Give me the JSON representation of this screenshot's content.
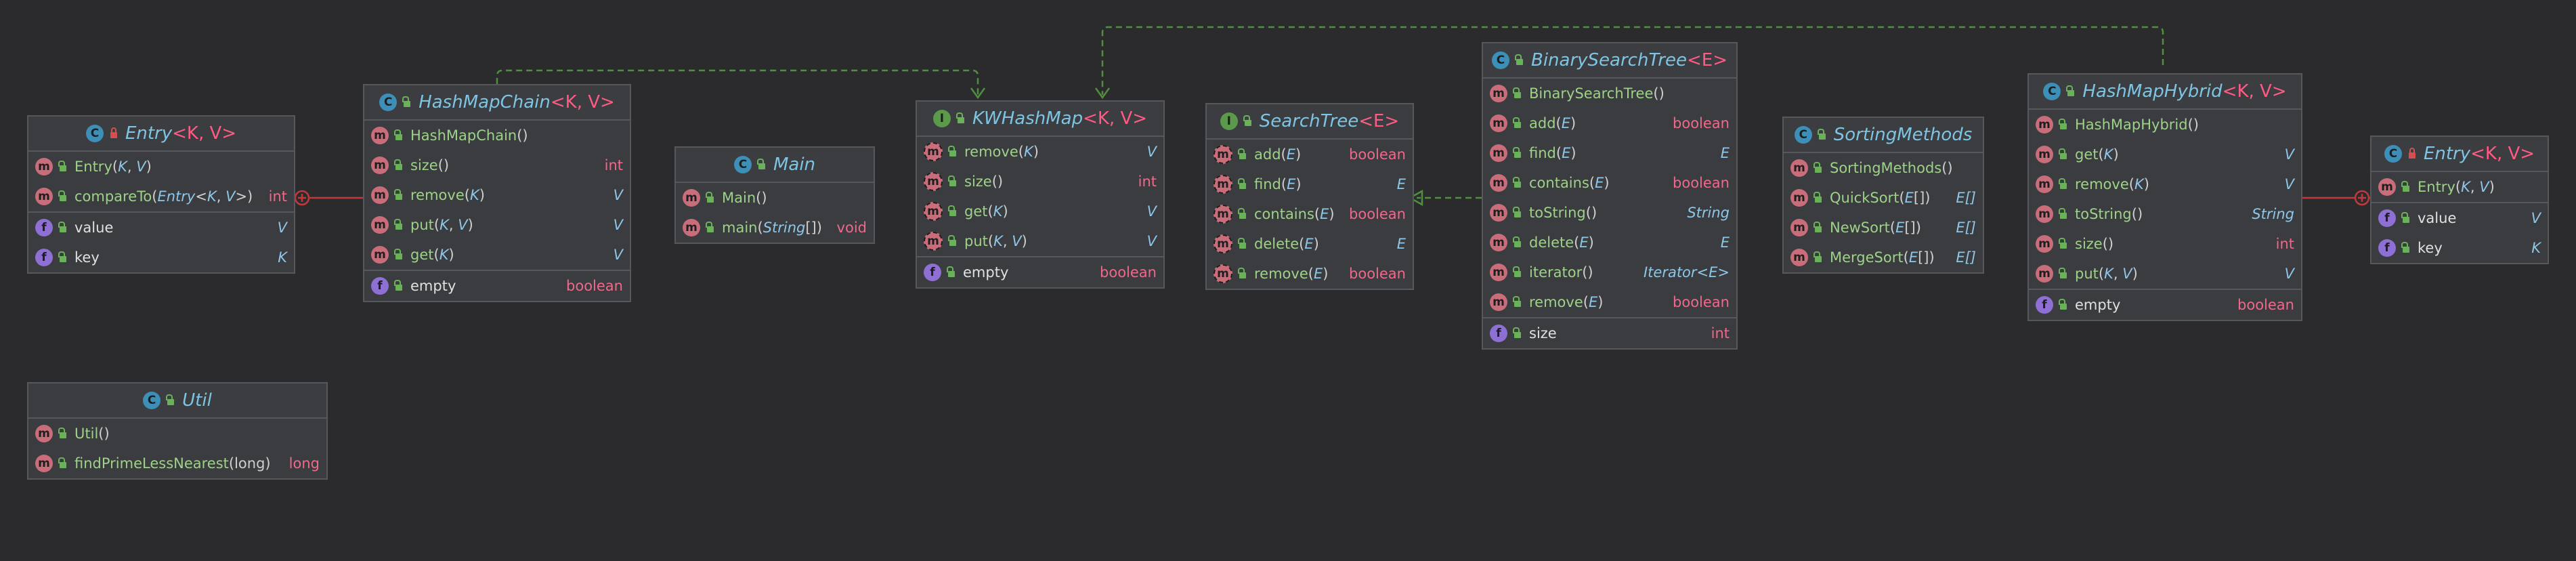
{
  "colors": {
    "background": "#2b2b2e",
    "box": "#3a3c3f",
    "border": "#55585c",
    "class_name": "#7ec4e3",
    "generics": "#ff5b84",
    "method_name": "#9fd18b",
    "keyword_type": "#ee6a8c",
    "dependency_line": "#4f8f3f",
    "inner_class_line": "#c0393b"
  },
  "classes": {
    "entry_left": {
      "icon": "class-icon",
      "name": "Entry",
      "generics": "<K, V>",
      "ctor_sig": "(K, V)",
      "rows": [
        {
          "kind": "method",
          "name": "Entry",
          "params": "(K, V)",
          "type": ""
        },
        {
          "kind": "method",
          "name": "compareTo",
          "params": "(Entry<K, V>)",
          "type": "int"
        },
        {
          "kind": "field",
          "name": "value",
          "params": "",
          "type": "V"
        },
        {
          "kind": "field",
          "name": "key",
          "params": "",
          "type": "K"
        }
      ]
    },
    "hashmap_chain": {
      "icon": "class-icon",
      "name": "HashMapChain",
      "generics": "<K, V>",
      "rows": [
        {
          "kind": "method",
          "name": "HashMapChain",
          "params": "()",
          "type": ""
        },
        {
          "kind": "method",
          "name": "size",
          "params": "()",
          "type": "int"
        },
        {
          "kind": "method",
          "name": "remove",
          "params": "(K)",
          "type": "V"
        },
        {
          "kind": "method",
          "name": "put",
          "params": "(K, V)",
          "type": "V"
        },
        {
          "kind": "method",
          "name": "get",
          "params": "(K)",
          "type": "V"
        },
        {
          "kind": "field",
          "name": "empty",
          "params": "",
          "type": "boolean"
        }
      ]
    },
    "main": {
      "icon": "class-icon",
      "name": "Main",
      "generics": "",
      "rows": [
        {
          "kind": "method",
          "name": "Main",
          "params": "()",
          "type": ""
        },
        {
          "kind": "method",
          "name": "main",
          "params": "(String[])",
          "type": "void"
        }
      ]
    },
    "kw_hashmap": {
      "icon": "interface-icon",
      "name": "KWHashMap",
      "generics": "<K, V>",
      "rows": [
        {
          "kind": "abs",
          "name": "remove",
          "params": "(K)",
          "type": "V"
        },
        {
          "kind": "abs",
          "name": "size",
          "params": "()",
          "type": "int"
        },
        {
          "kind": "abs",
          "name": "get",
          "params": "(K)",
          "type": "V"
        },
        {
          "kind": "abs",
          "name": "put",
          "params": "(K, V)",
          "type": "V"
        },
        {
          "kind": "field",
          "name": "empty",
          "params": "",
          "type": "boolean"
        }
      ]
    },
    "search_tree": {
      "icon": "interface-icon",
      "name": "SearchTree",
      "generics": "<E>",
      "rows": [
        {
          "kind": "abs",
          "name": "add",
          "params": "(E)",
          "type": "boolean"
        },
        {
          "kind": "abs",
          "name": "find",
          "params": "(E)",
          "type": "E"
        },
        {
          "kind": "abs",
          "name": "contains",
          "params": "(E)",
          "type": "boolean"
        },
        {
          "kind": "abs",
          "name": "delete",
          "params": "(E)",
          "type": "E"
        },
        {
          "kind": "abs",
          "name": "remove",
          "params": "(E)",
          "type": "boolean"
        }
      ]
    },
    "bst": {
      "icon": "class-icon",
      "name": "BinarySearchTree",
      "generics": "<E>",
      "rows": [
        {
          "kind": "method",
          "name": "BinarySearchTree",
          "params": "()",
          "type": ""
        },
        {
          "kind": "method",
          "name": "add",
          "params": "(E)",
          "type": "boolean"
        },
        {
          "kind": "method",
          "name": "find",
          "params": "(E)",
          "type": "E"
        },
        {
          "kind": "method",
          "name": "contains",
          "params": "(E)",
          "type": "boolean"
        },
        {
          "kind": "method",
          "name": "toString",
          "params": "()",
          "type": "String"
        },
        {
          "kind": "method",
          "name": "delete",
          "params": "(E)",
          "type": "E"
        },
        {
          "kind": "method",
          "name": "iterator",
          "params": "()",
          "type": "Iterator<E>"
        },
        {
          "kind": "method",
          "name": "remove",
          "params": "(E)",
          "type": "boolean"
        },
        {
          "kind": "field",
          "name": "size",
          "params": "",
          "type": "int"
        }
      ]
    },
    "sorting": {
      "icon": "class-icon",
      "name": "SortingMethods",
      "generics": "",
      "rows": [
        {
          "kind": "method",
          "name": "SortingMethods",
          "params": "()",
          "type": ""
        },
        {
          "kind": "method",
          "name": "QuickSort",
          "params": "(E[])",
          "type": "E[]"
        },
        {
          "kind": "method",
          "name": "NewSort",
          "params": "(E[])",
          "type": "E[]"
        },
        {
          "kind": "method",
          "name": "MergeSort",
          "params": "(E[])",
          "type": "E[]"
        }
      ]
    },
    "hashmap_hybrid": {
      "icon": "class-icon",
      "name": "HashMapHybrid",
      "generics": "<K, V>",
      "rows": [
        {
          "kind": "method",
          "name": "HashMapHybrid",
          "params": "()",
          "type": ""
        },
        {
          "kind": "method",
          "name": "get",
          "params": "(K)",
          "type": "V"
        },
        {
          "kind": "method",
          "name": "remove",
          "params": "(K)",
          "type": "V"
        },
        {
          "kind": "method",
          "name": "toString",
          "params": "()",
          "type": "String"
        },
        {
          "kind": "method",
          "name": "size",
          "params": "()",
          "type": "int"
        },
        {
          "kind": "method",
          "name": "put",
          "params": "(K, V)",
          "type": "V"
        },
        {
          "kind": "field",
          "name": "empty",
          "params": "",
          "type": "boolean"
        }
      ]
    },
    "entry_right": {
      "icon": "class-icon",
      "name": "Entry",
      "generics": "<K, V>",
      "rows": [
        {
          "kind": "method",
          "name": "Entry",
          "params": "(K, V)",
          "type": ""
        },
        {
          "kind": "field",
          "name": "value",
          "params": "",
          "type": "V"
        },
        {
          "kind": "field",
          "name": "key",
          "params": "",
          "type": "K"
        }
      ]
    },
    "util": {
      "icon": "class-icon",
      "name": "Util",
      "generics": "",
      "rows": [
        {
          "kind": "method",
          "name": "Util",
          "params": "()",
          "type": ""
        },
        {
          "kind": "method",
          "name": "findPrimeLessNearest",
          "params": "(long)",
          "type": "long"
        }
      ]
    }
  }
}
